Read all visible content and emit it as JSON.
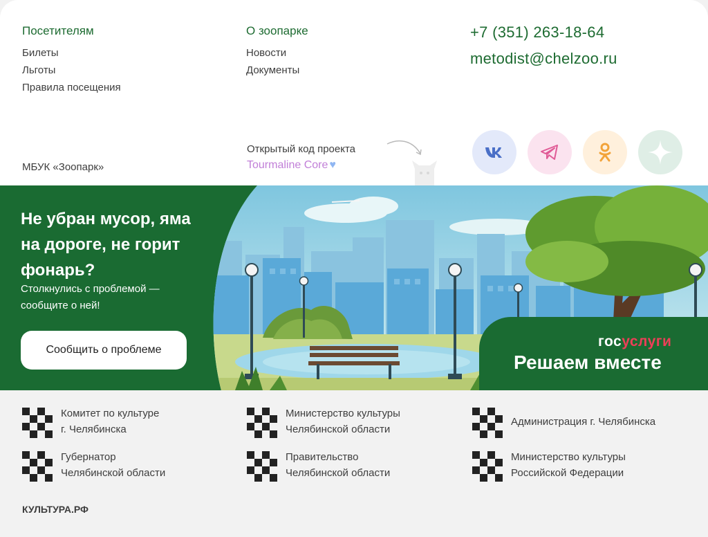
{
  "visitors": {
    "title": "Посетителям",
    "links": [
      "Билеты",
      "Льготы",
      "Правила посещения"
    ]
  },
  "about": {
    "title": "О зоопарке",
    "links": [
      "Новости",
      "Документы"
    ]
  },
  "contacts": {
    "phone": "+7 (351) 263-18-64",
    "email": "metodist@chelzoo.ru"
  },
  "org_name": "МБУК «Зоопарк»",
  "open_source": {
    "label": "Открытый код проекта",
    "link": "Tourmaline Core",
    "heart": "♥"
  },
  "social": [
    {
      "name": "vk-icon",
      "bg": "#e3e9fa",
      "color": "#4a6fc7"
    },
    {
      "name": "telegram-icon",
      "bg": "#fbe3ef",
      "color": "#e05a96"
    },
    {
      "name": "odnoklassniki-icon",
      "bg": "#fff0dc",
      "color": "#f2a33a"
    },
    {
      "name": "star-icon",
      "bg": "#dfeee6",
      "color": "#ffffff"
    }
  ],
  "banner": {
    "title": "Не убран мусор, яма на дороге, не горит фонарь?",
    "subtitle": "Столкнулись с проблемой — сообщите о ней!",
    "button": "Сообщить о проблеме",
    "gos_part1": "гос",
    "gos_part2": "услуги",
    "slogan": "Решаем вместе"
  },
  "partners": [
    {
      "text": "Комитет по культуре\n г. Челябинска"
    },
    {
      "text": "Министерство культуры\nЧелябинской области"
    },
    {
      "text": "Администрация г. Челябинска"
    },
    {
      "text": "Губернатор\nЧелябинской области"
    },
    {
      "text": "Правительство\nЧелябинской области"
    },
    {
      "text": "Министерство культуры\nРоссийской Федерации"
    }
  ],
  "kultura": "КУЛЬТУРА.РФ",
  "colors": {
    "brand_green": "#1d6b31",
    "banner_green": "#1a6b32",
    "gos_red": "#ee3f58",
    "accent_purple": "#c17fd8"
  }
}
